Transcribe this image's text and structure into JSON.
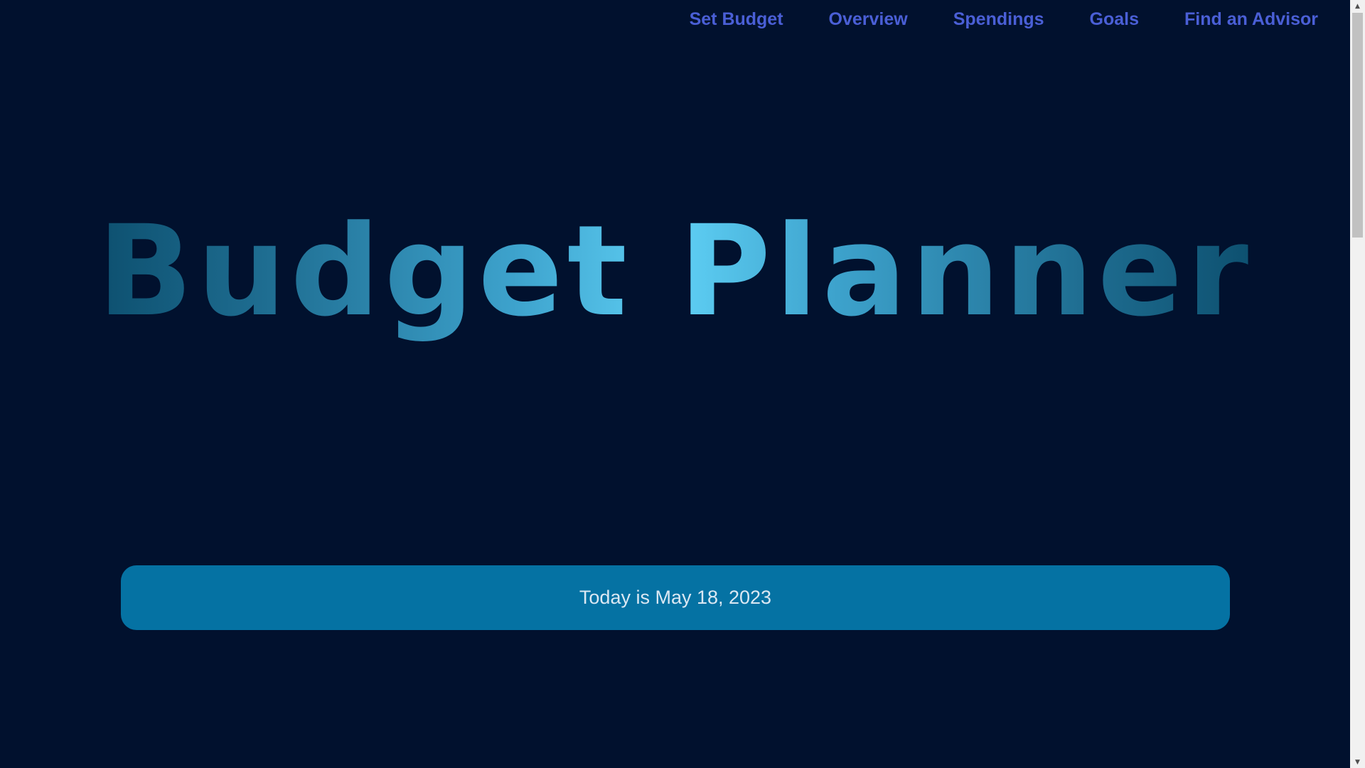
{
  "nav": {
    "items": [
      {
        "label": "Set Budget"
      },
      {
        "label": "Overview"
      },
      {
        "label": "Spendings"
      },
      {
        "label": "Goals"
      },
      {
        "label": "Find an Advisor"
      }
    ]
  },
  "hero": {
    "title": "Budget Planner"
  },
  "date_banner": {
    "text": "Today is May 18, 2023"
  },
  "scrollbar": {
    "up_icon": "triangle-up",
    "down_icon": "triangle-down"
  },
  "colors": {
    "background": "#01112e",
    "nav_link": "#4a5fd6",
    "banner": "#0572a3",
    "title_gradient_center": "#5fd0f5",
    "title_gradient_edge": "#033f5c"
  }
}
